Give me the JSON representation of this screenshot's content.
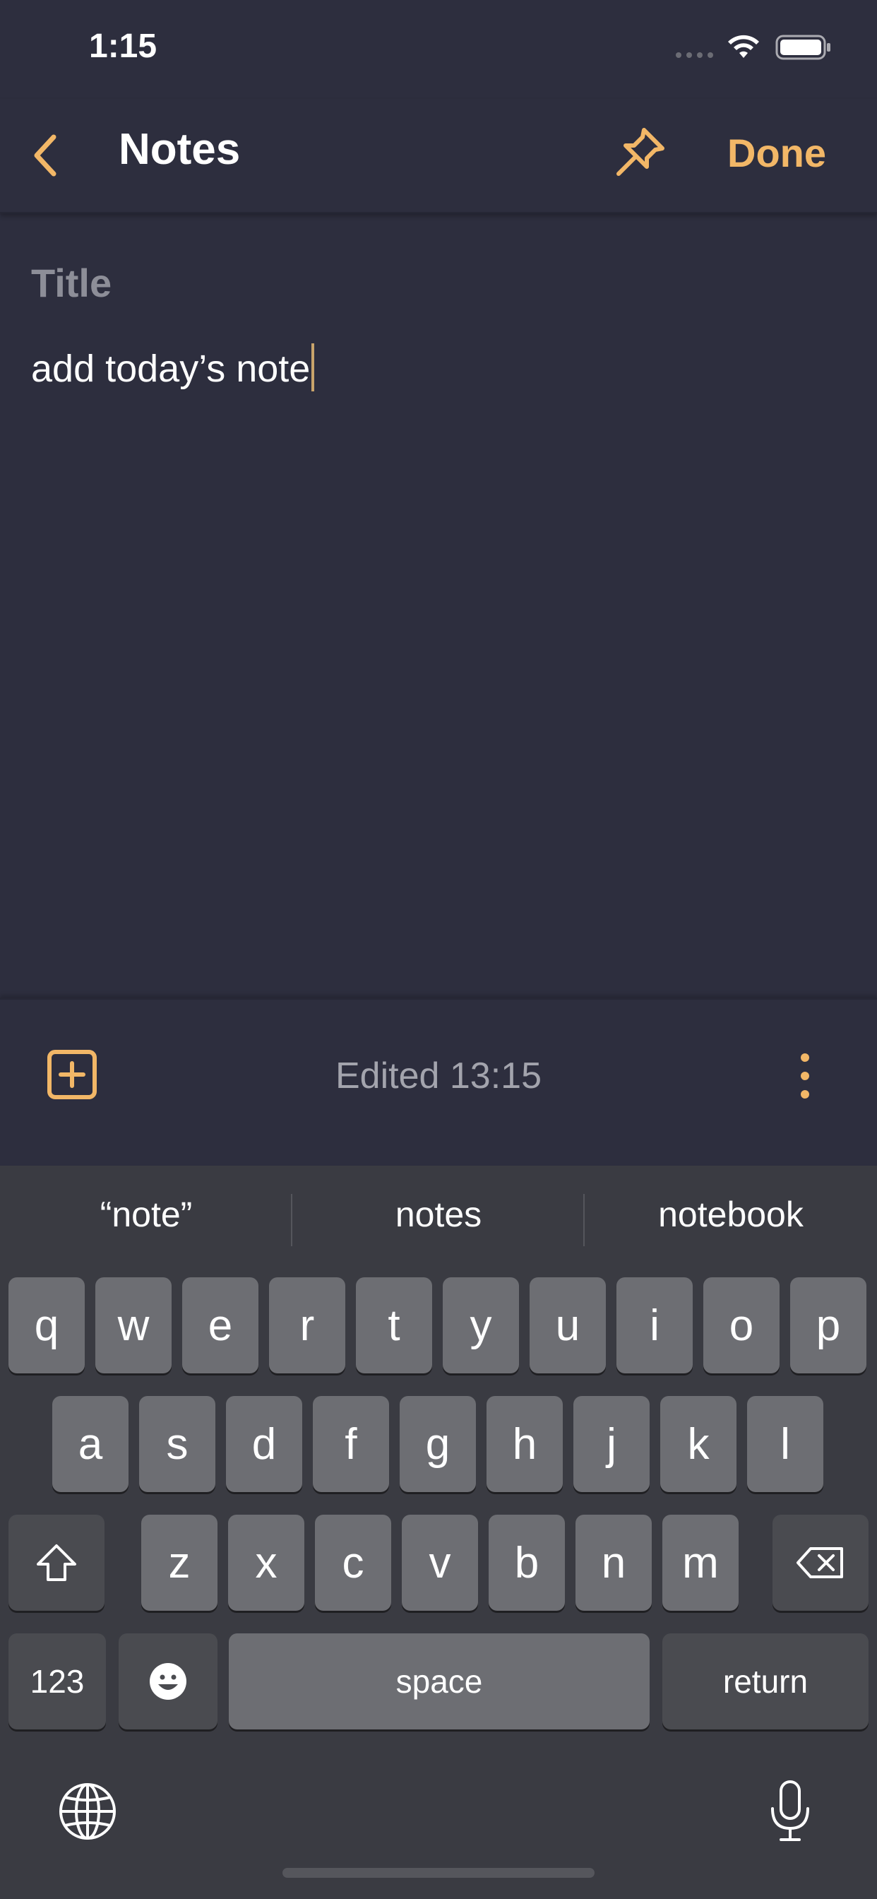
{
  "status_bar": {
    "time": "1:15",
    "icons": [
      "signal-icon",
      "wifi-icon",
      "battery-icon"
    ]
  },
  "nav": {
    "back_icon": "chevron-left-icon",
    "title": "Notes",
    "pin_icon": "pin-icon",
    "done_label": "Done"
  },
  "editor": {
    "title_placeholder": "Title",
    "body_text": "add today’s note"
  },
  "toolbar": {
    "add_icon": "plus-square-icon",
    "edited_label": "Edited 13:15",
    "more_icon": "more-vertical-icon"
  },
  "keyboard": {
    "suggestions": [
      "“note”",
      "notes",
      "notebook"
    ],
    "row1": [
      "q",
      "w",
      "e",
      "r",
      "t",
      "y",
      "u",
      "i",
      "o",
      "p"
    ],
    "row2": [
      "a",
      "s",
      "d",
      "f",
      "g",
      "h",
      "j",
      "k",
      "l"
    ],
    "row3": [
      "z",
      "x",
      "c",
      "v",
      "b",
      "n",
      "m"
    ],
    "numbers_label": "123",
    "space_label": "space",
    "return_label": "return",
    "shift_icon": "shift-icon",
    "delete_icon": "backspace-icon",
    "emoji_icon": "emoji-icon",
    "globe_icon": "globe-icon",
    "mic_icon": "microphone-icon"
  },
  "colors": {
    "background": "#2d2e3e",
    "accent": "#f2b767",
    "keyboard_bg": "#3a3b42",
    "key_bg": "#6d6e73",
    "key_dark_bg": "#4a4b50"
  }
}
